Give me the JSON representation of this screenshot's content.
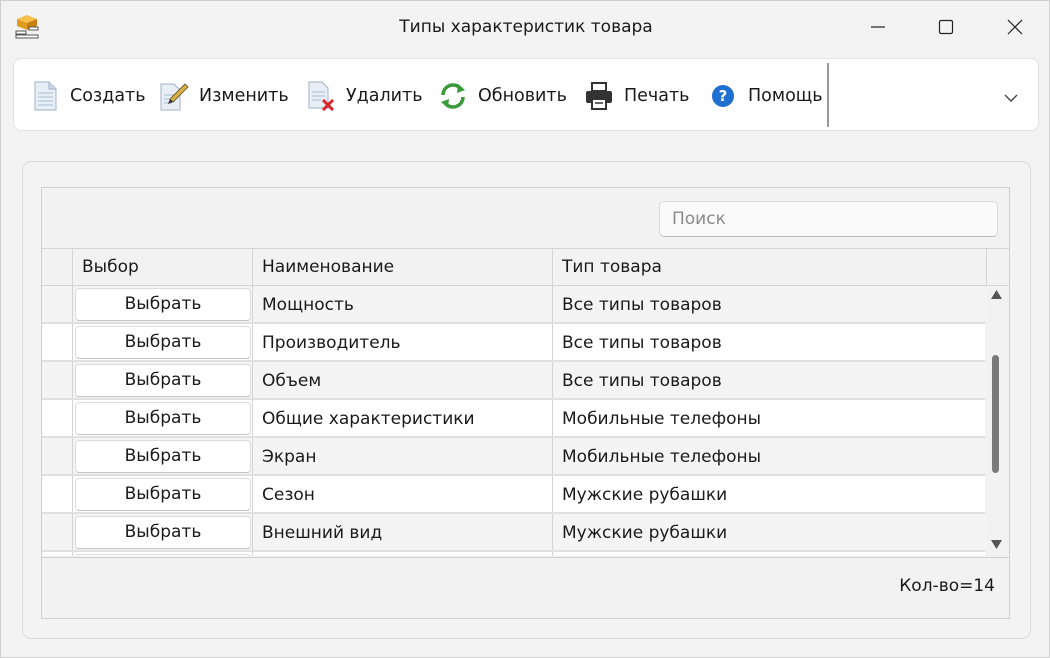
{
  "window": {
    "title": "Типы характеристик товара"
  },
  "toolbar": {
    "create": "Создать",
    "edit": "Изменить",
    "delete": "Удалить",
    "refresh": "Обновить",
    "print": "Печать",
    "help": "Помощь"
  },
  "search": {
    "placeholder": "Поиск"
  },
  "table": {
    "columns": [
      "",
      "Выбор",
      "Наименование",
      "Тип товара"
    ],
    "select_label": "Выбрать",
    "rows": [
      {
        "name": "Мощность",
        "type": "Все типы товаров"
      },
      {
        "name": "Производитель",
        "type": "Все типы товаров"
      },
      {
        "name": "Объем",
        "type": "Все типы товаров"
      },
      {
        "name": "Общие характеристики",
        "type": "Мобильные телефоны"
      },
      {
        "name": "Экран",
        "type": "Мобильные телефоны"
      },
      {
        "name": "Сезон",
        "type": "Мужские рубашки"
      },
      {
        "name": "Внешний вид",
        "type": "Мужские рубашки"
      }
    ]
  },
  "footer": {
    "count": "Кол-во=14"
  },
  "icons": {
    "app": "app-box-icon",
    "create": "document-icon",
    "edit": "pencil-document-icon",
    "delete": "delete-document-icon",
    "refresh": "refresh-icon",
    "print": "printer-icon",
    "help": "help-icon",
    "more": "chevron-down-icon"
  }
}
